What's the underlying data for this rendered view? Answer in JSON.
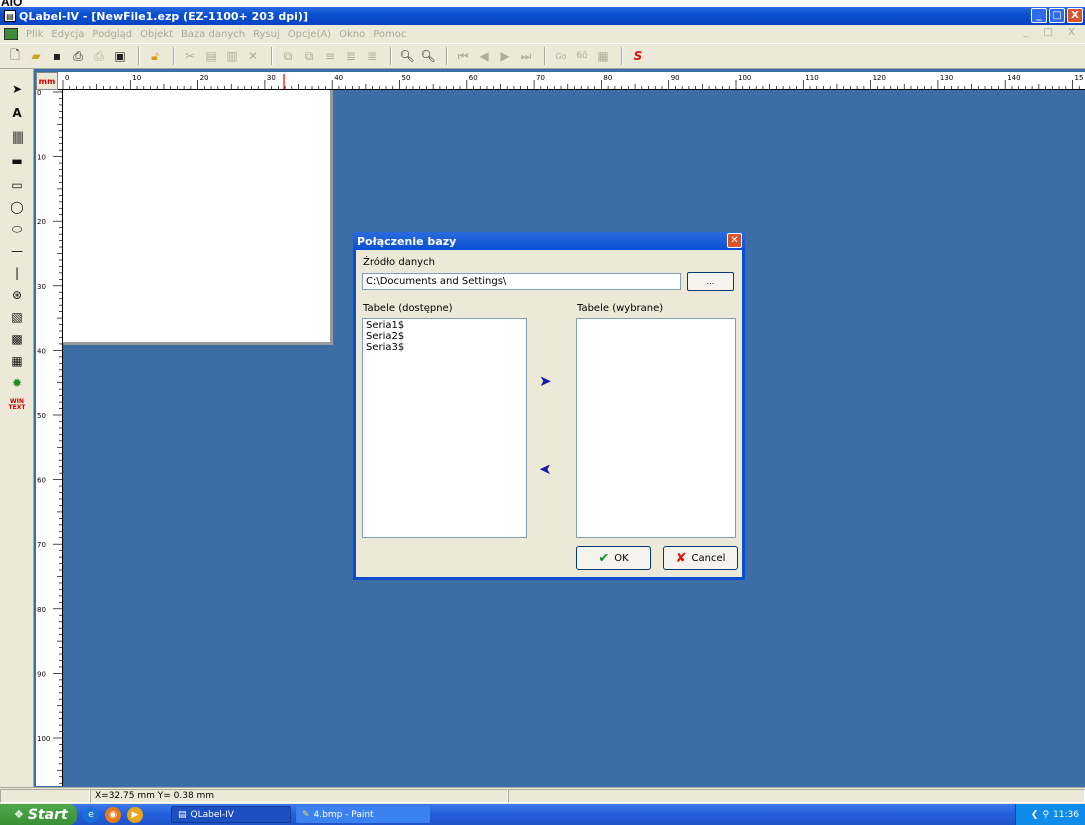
{
  "top_caption": "AIO",
  "window": {
    "title": "QLabel-IV  - [NewFile1.ezp    (EZ-1100+     203 dpi)]",
    "controls": [
      "_",
      "□",
      "X"
    ]
  },
  "menu": [
    "Plik",
    "Edycja",
    "Podgląd",
    "Objekt",
    "Baza danych",
    "Rysuj",
    "Opcje(A)",
    "Okno",
    "Pomoc"
  ],
  "menu_mdi_controls": "_ □ X",
  "toolbar": {
    "items": [
      "new-icon",
      "open-icon",
      "save-icon",
      "print-icon",
      "print-preview-icon",
      "copy-doc-icon",
      "lock-icon",
      "cut-icon",
      "paste-icon",
      "clipboard-icon",
      "delete-icon",
      "group-icon",
      "ungroup-icon",
      "align-icon",
      "distribute-icon",
      "zoom-out-icon",
      "zoom-in-icon",
      "first-icon",
      "prev-icon",
      "next-icon",
      "last-icon",
      "go-icon",
      "find-icon",
      "db-icon",
      "script-icon"
    ],
    "go_label": "Go",
    "find_label": "6ô"
  },
  "ruler": {
    "unit": "mm",
    "h_ticks": [
      "0",
      "10",
      "20",
      "30",
      "40",
      "50",
      "60",
      "70",
      "80",
      "90",
      "100",
      "110",
      "120",
      "130",
      "140",
      "15"
    ],
    "v_ticks": [
      "0",
      "10",
      "20",
      "30",
      "40",
      "50",
      "60",
      "70",
      "80",
      "90",
      "100"
    ]
  },
  "left_tools": [
    "pointer-icon",
    "text-icon",
    "barcode-icon",
    "filled-rect-icon",
    "rect-icon",
    "ellipse-icon",
    "rounded-rect-icon",
    "hline-icon",
    "vline-icon",
    "circle-pattern-icon",
    "pdf417-icon",
    "datamatrix-icon",
    "qr-icon",
    "image-icon",
    "win-text-icon"
  ],
  "left_text_label": "A",
  "left_win_label": "WIN\nTEXT",
  "dialog": {
    "title": "Połączenie bazy",
    "source_label": "Źródło danych",
    "source_value": "C:\\Documents and Settings\\",
    "browse_label": "...",
    "available_label": "Tabele (dostępne)",
    "available_items": [
      "Seria1$",
      "Seria2$",
      "Seria3$"
    ],
    "selected_label": "Tabele (wybrane)",
    "selected_items": [],
    "ok_label": "OK",
    "cancel_label": "Cancel"
  },
  "status": {
    "coords": "X=32.75 mm  Y= 0.38 mm"
  },
  "taskbar": {
    "start_label": "Start",
    "tasks": [
      "QLabel-IV",
      "4.bmp - Paint"
    ],
    "clock": "11:36"
  }
}
